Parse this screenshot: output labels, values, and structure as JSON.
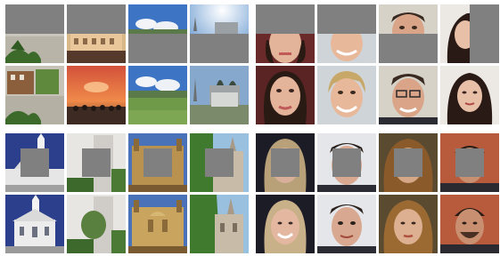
{
  "figure": {
    "panels": [
      {
        "scene": "outdoor-scenes",
        "mask": "half"
      },
      {
        "scene": "faces",
        "mask": "half"
      },
      {
        "scene": "churches",
        "mask": "center-square"
      },
      {
        "scene": "faces",
        "mask": "center-square"
      }
    ],
    "rows_per_panel": [
      "masked-input",
      "completed-output"
    ],
    "columns_per_panel": 4
  },
  "palette": {
    "mask": "#808080",
    "background": "#ffffff"
  }
}
